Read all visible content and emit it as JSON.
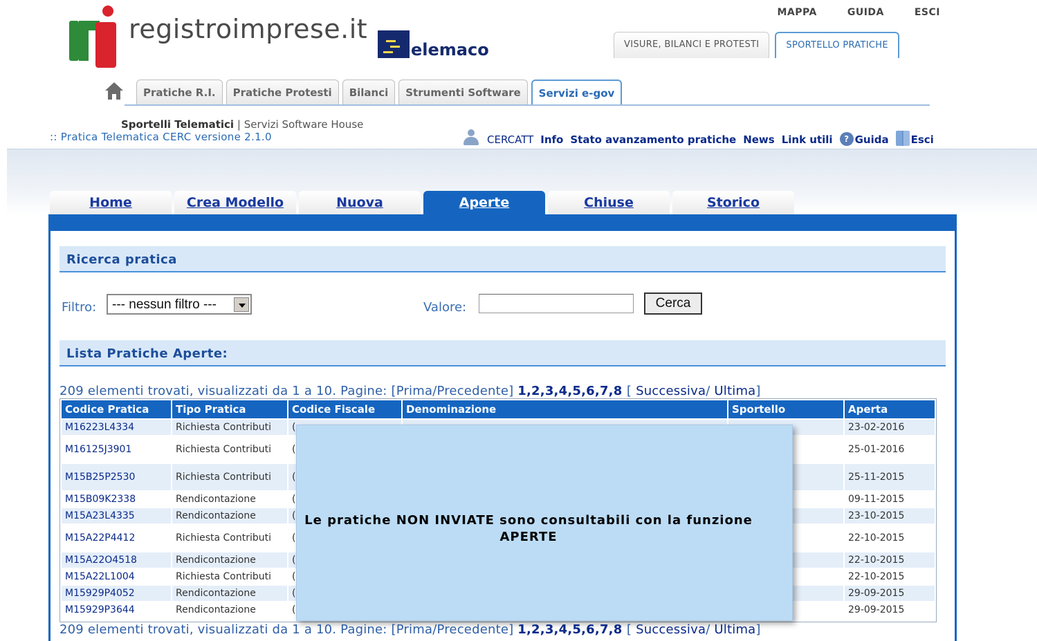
{
  "brand": {
    "site_name": "registroimprese.it",
    "partner": "Telemaco"
  },
  "top_links": [
    "MAPPA",
    "GUIDA",
    "ESCI"
  ],
  "top_tabs": [
    {
      "label": "VISURE, BILANCI E PROTESTI",
      "active": false
    },
    {
      "label": "SPORTELLO PRATICHE",
      "active": true
    }
  ],
  "nav_tabs": [
    {
      "label": "Pratiche R.I.",
      "active": false
    },
    {
      "label": "Pratiche Protesti",
      "active": false
    },
    {
      "label": "Bilanci",
      "active": false
    },
    {
      "label": "Strumenti Software",
      "active": false
    },
    {
      "label": "Servizi e-gov",
      "active": true
    }
  ],
  "subheader": {
    "sportelli": "Sportelli Telematici",
    "separator": "|",
    "software_house": "Servizi Software House",
    "version": ":: Pratica Telematica CERC versione 2.1.0"
  },
  "utility_links": {
    "cercatt": "CERCATT",
    "info": "Info",
    "stato": "Stato avanzamento pratiche",
    "news": "News",
    "link_utili": "Link utili",
    "guida": "Guida",
    "esci": "Esci"
  },
  "main_tabs": [
    {
      "label": "Home",
      "active": false
    },
    {
      "label": "Crea Modello",
      "active": false
    },
    {
      "label": "Nuova",
      "active": false
    },
    {
      "label": "Aperte",
      "active": true
    },
    {
      "label": "Chiuse",
      "active": false
    },
    {
      "label": "Storico",
      "active": false
    }
  ],
  "search": {
    "title": "Ricerca pratica",
    "filter_label": "Filtro:",
    "filter_value": "--- nessun filtro ---",
    "valore_label": "Valore:",
    "valore_value": "",
    "button": "Cerca"
  },
  "list": {
    "title": "Lista Pratiche Aperte:",
    "pager_text": "209 elementi trovati, visualizzati da 1 a 10. Pagine: [Prima/Precedente]",
    "current_page": "1",
    "pages": [
      "2",
      "3",
      "4",
      "5",
      "6",
      "7",
      "8"
    ],
    "next": "Successiva",
    "last": "Ultima",
    "columns": [
      "Codice Pratica",
      "Tipo Pratica",
      "Codice Fiscale",
      "Denominazione",
      "Sportello",
      "Aperta"
    ],
    "rows": [
      {
        "codice": "M16223L4334",
        "tipo": "Richiesta Contributi",
        "aperta": "23-02-2016"
      },
      {
        "codice": "M16125J3901",
        "tipo": "Richiesta Contributi",
        "aperta": "25-01-2016"
      },
      {
        "codice": "M15B25P2530",
        "tipo": "Richiesta Contributi",
        "aperta": "25-11-2015"
      },
      {
        "codice": "M15B09K2338",
        "tipo": "Rendicontazione",
        "aperta": "09-11-2015"
      },
      {
        "codice": "M15A23L4335",
        "tipo": "Rendicontazione",
        "aperta": "23-10-2015"
      },
      {
        "codice": "M15A22P4412",
        "tipo": "Richiesta Contributi",
        "aperta": "22-10-2015"
      },
      {
        "codice": "M15A22O4518",
        "tipo": "Rendicontazione",
        "aperta": "22-10-2015"
      },
      {
        "codice": "M15A22L1004",
        "tipo": "Richiesta Contributi",
        "aperta": "22-10-2015"
      },
      {
        "codice": "M15929P4052",
        "tipo": "Rendicontazione",
        "aperta": "29-09-2015"
      },
      {
        "codice": "M15929P3644",
        "tipo": "Rendicontazione",
        "aperta": "29-09-2015"
      }
    ],
    "cell_fragment": "("
  },
  "overlay": {
    "line1": "Le pratiche NON INVIATE sono consultabili con la funzione",
    "line2": "APERTE"
  },
  "icons": [
    "home-icon",
    "user-icon",
    "help-icon",
    "book-icon",
    "dropdown-arrow-icon"
  ],
  "colors": {
    "primary_blue": "#1565c0",
    "section_bg": "#d8e8f8",
    "overlay_bg": "#bcdcf5",
    "link": "#0a2a8a"
  }
}
